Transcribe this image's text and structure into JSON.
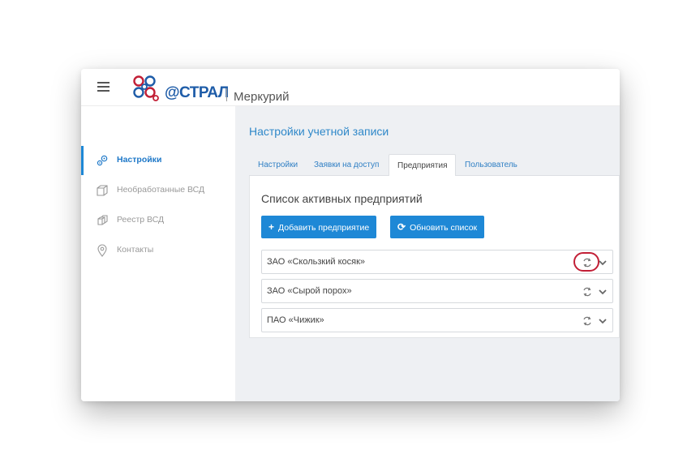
{
  "header": {
    "brand": "@СТРАЛ",
    "product": "Меркурий"
  },
  "sidebar": {
    "items": [
      {
        "label": "Настройки",
        "icon": "gears-icon",
        "active": true
      },
      {
        "label": "Необработанные ВСД",
        "icon": "box-icon",
        "active": false
      },
      {
        "label": "Реестр ВСД",
        "icon": "boxes-icon",
        "active": false
      },
      {
        "label": "Контакты",
        "icon": "map-pin-icon",
        "active": false
      }
    ]
  },
  "main": {
    "title": "Настройки учетной записи",
    "tabs": [
      {
        "label": "Настройки",
        "active": false
      },
      {
        "label": "Заявки на доступ",
        "active": false
      },
      {
        "label": "Предприятия",
        "active": true
      },
      {
        "label": "Пользователь",
        "active": false
      }
    ],
    "panel_title": "Список активных предприятий",
    "add_button": {
      "icon": "+",
      "label": "Добавить предприятие"
    },
    "refresh_button": {
      "icon": "⟳",
      "label": "Обновить список"
    },
    "enterprises": [
      {
        "name": "ЗАО «Скользкий косяк»",
        "highlighted": true
      },
      {
        "name": "ЗАО «Сырой порох»",
        "highlighted": false
      },
      {
        "name": "ПАО «Чижик»",
        "highlighted": false
      }
    ]
  },
  "colors": {
    "accent": "#1e88d6",
    "title_blue": "#2f88c9",
    "brand_blue": "#1e5ca8",
    "brand_red": "#c21f36",
    "highlight_ring": "#c21f36",
    "main_bg": "#eef0f3"
  }
}
